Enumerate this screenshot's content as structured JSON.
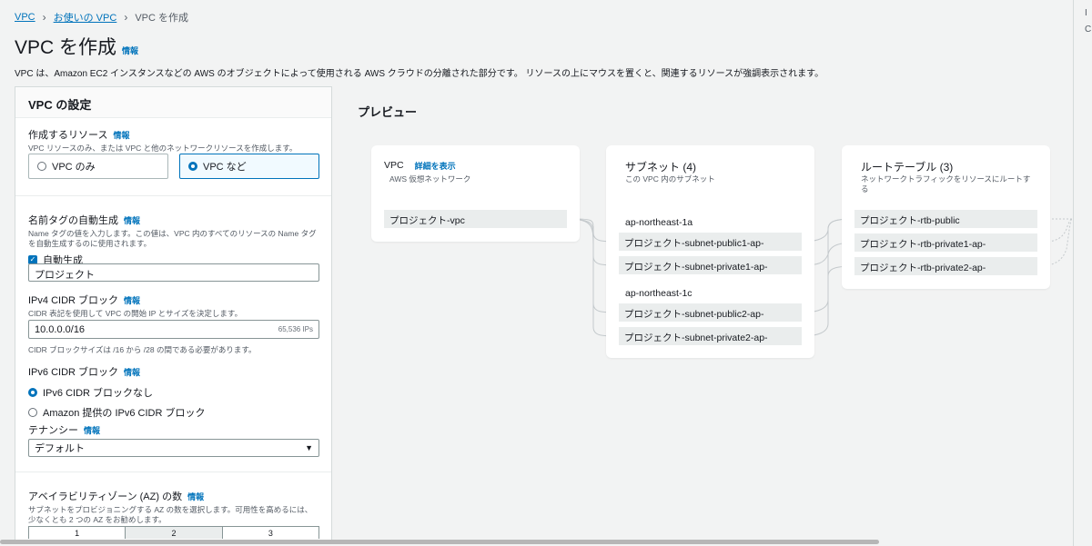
{
  "breadcrumb": {
    "vpc": "VPC",
    "your_vpcs": "お使いの VPC",
    "current": "VPC を作成"
  },
  "page": {
    "title": "VPC を作成",
    "title_info": "情報",
    "description": "VPC は、Amazon EC2 インスタンスなどの AWS のオブジェクトによって使用される AWS クラウドの分離された部分です。 リソースの上にマウスを置くと、関連するリソースが強調表示されます。"
  },
  "settings": {
    "header": "VPC の設定",
    "resources": {
      "label": "作成するリソース",
      "info": "情報",
      "description": "VPC リソースのみ、または VPC と他のネットワークリソースを作成します。",
      "option_vpc_only": "VPC のみ",
      "option_vpc_more": "VPC など"
    },
    "name_tag": {
      "label": "名前タグの自動生成",
      "info": "情報",
      "description": "Name タグの値を入力します。この値は、VPC 内のすべてのリソースの Name タグを自動生成するのに使用されます。",
      "checkbox_label": "自動生成",
      "value": "プロジェクト"
    },
    "ipv4": {
      "label": "IPv4 CIDR ブロック",
      "info": "情報",
      "description": "CIDR 表記を使用して VPC の開始 IP とサイズを決定します。",
      "value": "10.0.0.0/16",
      "ip_count": "65,536 IPs",
      "hint": "CIDR ブロックサイズは /16 から /28 の間である必要があります。"
    },
    "ipv6": {
      "label": "IPv6 CIDR ブロック",
      "info": "情報",
      "option_none": "IPv6 CIDR ブロックなし",
      "option_amazon": "Amazon 提供の IPv6 CIDR ブロック"
    },
    "tenancy": {
      "label": "テナンシー",
      "info": "情報",
      "value": "デフォルト"
    },
    "az": {
      "label": "アベイラビリティゾーン (AZ) の数",
      "info": "情報",
      "description": "サブネットをプロビジョニングする AZ の数を選択します。可用性を高めるには、少なくとも 2 つの AZ をお勧めします。",
      "options": [
        "1",
        "2",
        "3"
      ],
      "selected": "2"
    }
  },
  "preview": {
    "title": "プレビュー",
    "vpc": {
      "title": "VPC",
      "details_link": "詳細を表示",
      "subtitle": "AWS 仮想ネットワーク",
      "item": "プロジェクト-vpc"
    },
    "subnets": {
      "title": "サブネット (4)",
      "subtitle": "この VPC 内のサブネット",
      "az1": "ap-northeast-1a",
      "az2": "ap-northeast-1c",
      "items": [
        "プロジェクト-subnet-public1-ap-",
        "プロジェクト-subnet-private1-ap-",
        "プロジェクト-subnet-public2-ap-",
        "プロジェクト-subnet-private2-ap-"
      ]
    },
    "route_tables": {
      "title": "ルートテーブル (3)",
      "subtitle": "ネットワークトラフィックをリソースにルートする",
      "items": [
        "プロジェクト-rtb-public",
        "プロジェクト-rtb-private1-ap-",
        "プロジェクト-rtb-private2-ap-"
      ]
    }
  },
  "right_strip": {
    "line1": "I",
    "line2": "C"
  }
}
